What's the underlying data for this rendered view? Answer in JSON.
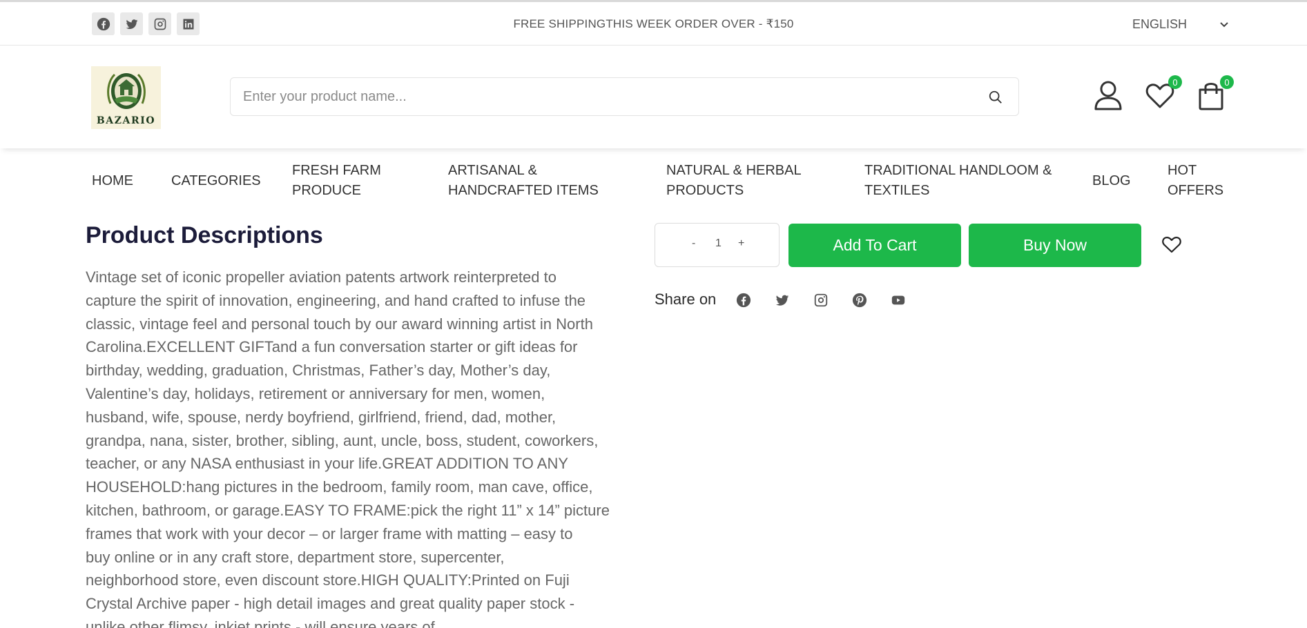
{
  "topbar": {
    "social": [
      {
        "name": "facebook-icon"
      },
      {
        "name": "twitter-icon"
      },
      {
        "name": "instagram-icon"
      },
      {
        "name": "linkedin-icon"
      }
    ],
    "promo": "FREE SHIPPINGTHIS WEEK ORDER OVER - ₹150",
    "language": "ENGLISH"
  },
  "header": {
    "logo_text": "BAZARIO",
    "search_placeholder": "Enter your product name...",
    "wishlist_count": "0",
    "cart_count": "0"
  },
  "nav": {
    "home": "HOME",
    "categories": "CATEGORIES",
    "fresh_1": "FRESH FARM",
    "fresh_2": "PRODUCE",
    "artisanal_1": "ARTISANAL &",
    "artisanal_2": "HANDCRAFTED ITEMS",
    "natural_1": "NATURAL & HERBAL",
    "natural_2": "PRODUCTS",
    "traditional_1": "TRADITIONAL HANDLOOM &",
    "traditional_2": "TEXTILES",
    "blog": "BLOG",
    "hot_1": "HOT",
    "hot_2": "OFFERS"
  },
  "product": {
    "desc_title": "Product Descriptions",
    "desc_lines": [
      "Vintage set of iconic propeller aviation patents artwork reinterpreted to",
      "capture the spirit of innovation, engineering, and hand crafted to infuse the",
      "classic, vintage feel and personal touch by our award winning artist in North",
      "Carolina.EXCELLENT GIFTand a fun conversation starter or gift ideas for",
      "birthday, wedding, graduation, Christmas, Father’s day, Mother’s day,",
      "Valentine’s day, holidays, retirement or anniversary for men, women,",
      "husband, wife, spouse, nerdy boyfriend, girlfriend, friend, dad, mother,",
      "grandpa, nana, sister, brother, sibling, aunt, uncle, boss, student, coworkers,",
      "teacher, or any NASA enthusiast in your life.GREAT ADDITION TO ANY",
      "HOUSEHOLD:hang pictures in the bedroom, family room, man cave, office,",
      "kitchen, bathroom, or garage.EASY TO FRAME:pick the right 11” x 14” picture",
      "frames that work with your decor – or larger frame with matting – easy to",
      "buy online or in any craft store, department store, supercenter,",
      "neighborhood store, even discount store.HIGH QUALITY:Printed on Fuji",
      "Crystal Archive paper - high detail images and great quality paper stock -",
      "unlike other flimsy, inkjet prints - will ensure years of"
    ],
    "qty_minus": "-",
    "qty_value": "1",
    "qty_plus": "+",
    "add_to_cart": "Add To Cart",
    "buy_now": "Buy Now",
    "share_label": "Share on",
    "share_icons": [
      "facebook-icon",
      "twitter-icon",
      "instagram-icon",
      "pinterest-icon",
      "youtube-icon"
    ]
  },
  "colors": {
    "accent": "#1db84a",
    "text": "#333333",
    "muted": "#666666"
  }
}
